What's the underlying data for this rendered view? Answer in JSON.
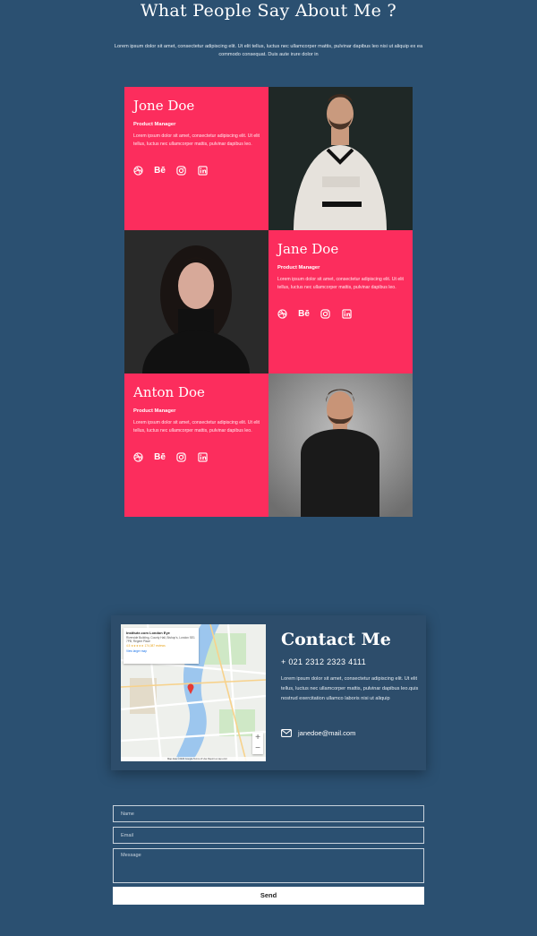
{
  "section": {
    "title": "What People Say About Me ?",
    "subtitle": "Lorem ipsum dolor sit amet, consectetur adipiscing elit. Ut elit tellus, luctus nec ullamcorper mattis, pulvinar dapibus leo nisi ut aliquip ex ea commodo consequat. Duis aute irure dolor in"
  },
  "people": [
    {
      "name": "Jone Doe",
      "role": "Product Manager",
      "bio": "Lorem ipsum dolor sit amet, consectetur adipiscing elit. Ut elit tellus, luctus nec ullamcorper mattis, pulvinar dapibus leo."
    },
    {
      "name": "Jane Doe",
      "role": "Product Manager",
      "bio": "Lorem ipsum dolor sit amet, consectetur adipiscing elit. Ut elit tellus, luctus nec ullamcorper mattis, pulvinar dapibus leo."
    },
    {
      "name": "Anton Doe",
      "role": "Product Manager",
      "bio": "Lorem ipsum dolor sit amet, consectetur adipiscing elit. Ut elit tellus, luctus nec ullamcorper mattis, pulvinar dapibus leo."
    }
  ],
  "social_icons": [
    "dribbble-icon",
    "behance-icon",
    "instagram-icon",
    "linkedin-icon"
  ],
  "social_behance_label": "Bē",
  "map": {
    "place": "Institute.com London Eye",
    "address": "Riverside Building, County Hall, Bishop's, London SE1 7PB, Regent Place",
    "rating": "4.5 ★★★★★ 174,087 reviews",
    "link": "View larger map",
    "footer": "Map data ©2023 Google  Terms of Use  Report a map error",
    "zoom_in": "+",
    "zoom_out": "−"
  },
  "contact": {
    "title": "Contact Me",
    "phone": "+ 021 2312 2323 4111",
    "body": "Lorem ipsum dolor sit amet, consectetur adipiscing elit. Ut elit tellus, luctus nec ullamcorper mattis, pulvinar dapibus leo.quis nostrud exercitation ullamco laboris nisi ut aliquip",
    "email": "janedoe@mail.com"
  },
  "form": {
    "name_placeholder": "Name",
    "email_placeholder": "Email",
    "message_placeholder": "Message",
    "send_label": "Send"
  },
  "colors": {
    "background": "#2b5071",
    "accent": "#fc2d5d",
    "card": "#2d4d6b"
  }
}
